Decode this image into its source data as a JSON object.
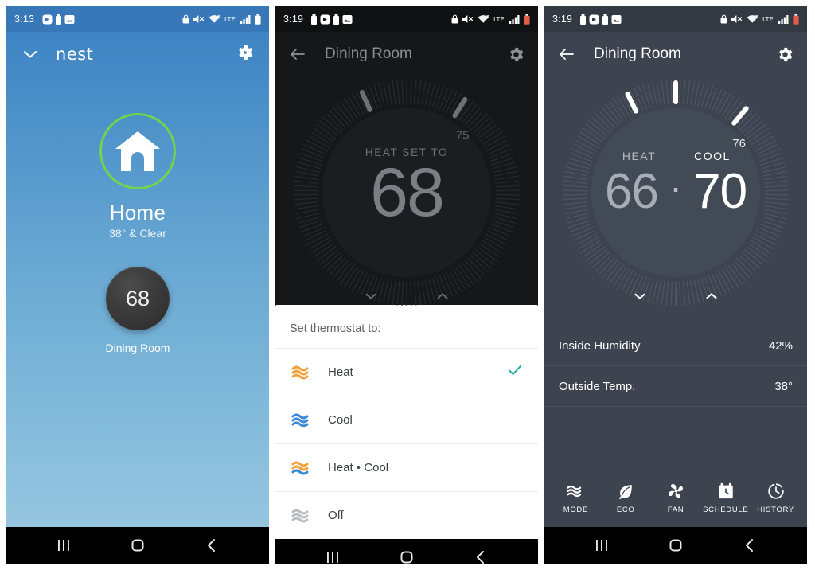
{
  "panel_home": {
    "statusbar": {
      "clock": "3:13",
      "left_icons": [
        "screen-record-icon",
        "battery-saver-icon",
        "photo-icon"
      ],
      "right_icons": [
        "lock-icon",
        "mute-icon",
        "wifi-icon",
        "lte-icon",
        "signal-icon",
        "battery-icon"
      ]
    },
    "header": {
      "collapse_icon": "chevron-down-icon",
      "brand": "nest",
      "settings_icon": "gear-icon"
    },
    "home": {
      "icon": "house-icon",
      "ring_color": "#6fd44f",
      "name": "Home",
      "weather": "38° & Clear"
    },
    "device": {
      "temperature": "68",
      "label": "Dining Room"
    },
    "navbar": {
      "recents": "recents-icon",
      "home": "home-icon",
      "back": "back-icon"
    }
  },
  "panel_mode_picker": {
    "statusbar": {
      "clock": "3:19",
      "left_icons": [
        "battery-saver-icon",
        "screen-record-icon",
        "battery-saver-icon",
        "photo-icon"
      ],
      "right_icons": [
        "lock-icon",
        "mute-icon",
        "wifi-icon",
        "lte-icon",
        "signal-icon",
        "battery-icon"
      ]
    },
    "header": {
      "back_icon": "arrow-left-icon",
      "title": "Dining Room",
      "settings_icon": "gear-icon"
    },
    "dial": {
      "kicker": "HEAT SET TO",
      "value": "68",
      "tick_label": "75",
      "decrease_icon": "chevron-down-icon",
      "increase_icon": "chevron-up-icon"
    },
    "sheet": {
      "title": "Set thermostat to:",
      "check_icon": "check-icon",
      "check_color": "#1aa5a0",
      "options": [
        {
          "label": "Heat",
          "icon": "heat-waves-icon",
          "selected": true,
          "color": "#f0a23c"
        },
        {
          "label": "Cool",
          "icon": "cool-waves-icon",
          "selected": false,
          "color": "#3b87d8"
        },
        {
          "label": "Heat • Cool",
          "icon": "heat-cool-waves-icon",
          "selected": false,
          "color": "#f0a23c"
        },
        {
          "label": "Off",
          "icon": "off-waves-icon",
          "selected": false,
          "color": "#b9bec4"
        }
      ]
    },
    "navbar": {
      "recents": "recents-icon",
      "home": "home-icon",
      "back": "back-icon"
    }
  },
  "panel_heat_cool": {
    "statusbar": {
      "clock": "3:19",
      "left_icons": [
        "battery-saver-icon",
        "screen-record-icon",
        "battery-saver-icon",
        "photo-icon"
      ],
      "right_icons": [
        "lock-icon",
        "mute-icon",
        "wifi-icon",
        "lte-icon",
        "signal-icon",
        "battery-icon"
      ]
    },
    "header": {
      "back_icon": "arrow-left-icon",
      "title": "Dining Room",
      "settings_icon": "gear-icon"
    },
    "dial": {
      "heat_label": "HEAT",
      "cool_label": "COOL",
      "heat_value": "66",
      "separator": "·",
      "cool_value": "70",
      "tick_label": "76",
      "decrease_icon": "chevron-down-icon",
      "increase_icon": "chevron-up-icon"
    },
    "info_rows": [
      {
        "label": "Inside Humidity",
        "value": "42%"
      },
      {
        "label": "Outside Temp.",
        "value": "38°"
      }
    ],
    "toolbar": [
      {
        "label": "MODE",
        "icon": "waves-icon"
      },
      {
        "label": "ECO",
        "icon": "leaf-icon"
      },
      {
        "label": "FAN",
        "icon": "fan-icon"
      },
      {
        "label": "SCHEDULE",
        "icon": "calendar-clock-icon"
      },
      {
        "label": "HISTORY",
        "icon": "clock-icon"
      }
    ],
    "navbar": {
      "recents": "recents-icon",
      "home": "home-icon",
      "back": "back-icon"
    }
  }
}
